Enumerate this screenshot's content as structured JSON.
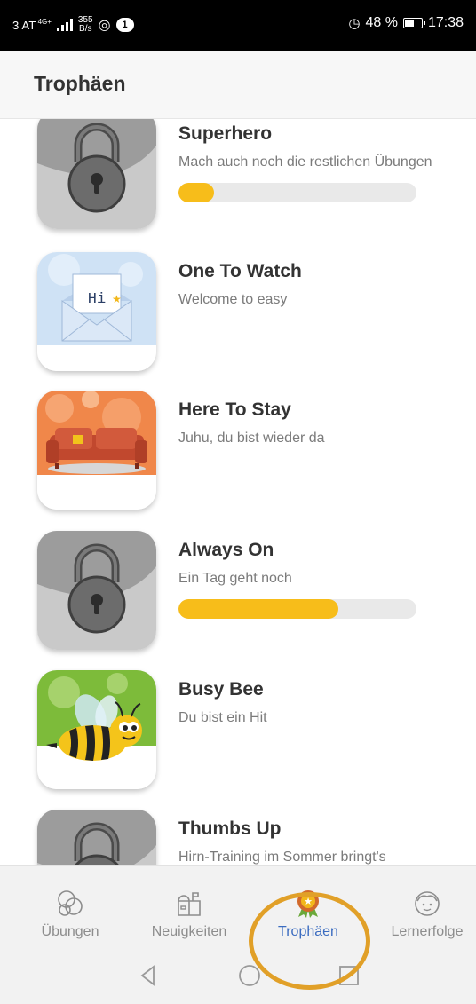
{
  "status_bar": {
    "network": "3 AT",
    "network_sup": "4G+",
    "speed_value": "355",
    "speed_unit": "B/s",
    "notification_count": "1",
    "battery": "48 %",
    "time": "17:38"
  },
  "app_bar": {
    "title": "Trophäen"
  },
  "trophies": [
    {
      "title": "Superhero",
      "subtitle": "Mach auch noch die restlichen Übungen",
      "locked": true,
      "progress": 0.15,
      "icon": "lock-icon"
    },
    {
      "title": "One To Watch",
      "subtitle": "Welcome to easy",
      "locked": false,
      "icon": "envelope-hi-icon",
      "badge_text": "Hi"
    },
    {
      "title": "Here To Stay",
      "subtitle": "Juhu, du bist wieder da",
      "locked": false,
      "icon": "sofa-icon"
    },
    {
      "title": "Always On",
      "subtitle": "Ein Tag geht noch",
      "locked": true,
      "progress": 0.67,
      "icon": "lock-icon"
    },
    {
      "title": "Busy Bee",
      "subtitle": "Du bist ein Hit",
      "locked": false,
      "icon": "bee-icon"
    },
    {
      "title": "Thumbs Up",
      "subtitle": "Hirn-Training im Sommer bringt's",
      "locked": true,
      "icon": "lock-icon"
    }
  ],
  "bottom_nav": {
    "items": [
      {
        "label": "Übungen",
        "icon": "bubbles-icon",
        "active": false
      },
      {
        "label": "Neuigkeiten",
        "icon": "mailbox-icon",
        "active": false
      },
      {
        "label": "Trophäen",
        "icon": "medal-icon",
        "active": true
      },
      {
        "label": "Lernerfolge",
        "icon": "face-icon",
        "active": false
      }
    ]
  },
  "colors": {
    "accent": "#3b6cc0",
    "progress": "#f7bd1a",
    "highlight": "#e1a028"
  }
}
